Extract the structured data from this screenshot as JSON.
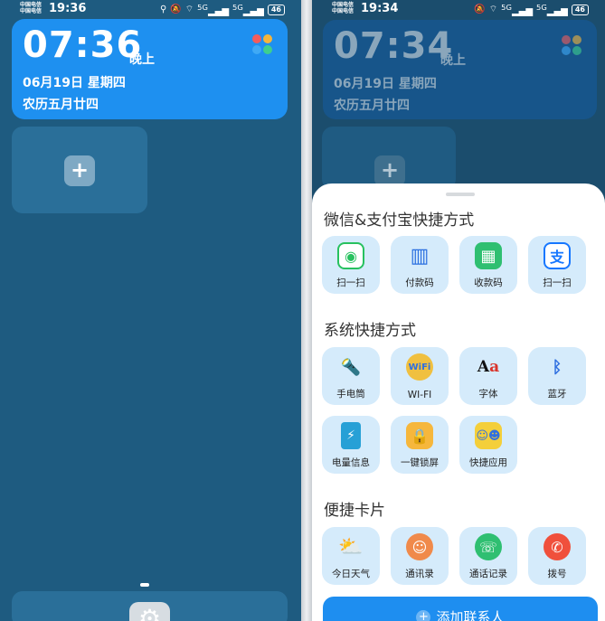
{
  "left": {
    "status": {
      "carrier1": "中国电信",
      "carrier2": "中国电信",
      "time": "19:36",
      "signal1": "5G",
      "signal2": "5G",
      "battery": "46"
    },
    "clock": {
      "time": "07:36",
      "period": "晚上",
      "date": "06月19日  星期四",
      "lunar": "农历五月廿四"
    },
    "add_label": "+"
  },
  "right": {
    "status": {
      "carrier1": "中国电信",
      "carrier2": "中国电信",
      "time": "19:34",
      "signal1": "5G",
      "signal2": "5G",
      "battery": "46"
    },
    "clock": {
      "time": "07:34",
      "period": "晚上",
      "date": "06月19日  星期四",
      "lunar": "农历五月廿四"
    },
    "add_label": "+",
    "sheet": {
      "sections": [
        {
          "title": "微信&支付宝快捷方式",
          "items": [
            {
              "label": "扫一扫",
              "icon": "wechat-scan-icon"
            },
            {
              "label": "付款码",
              "icon": "barcode-icon"
            },
            {
              "label": "收款码",
              "icon": "qr-code-icon"
            },
            {
              "label": "扫一扫",
              "icon": "alipay-scan-icon"
            }
          ]
        },
        {
          "title": "系统快捷方式",
          "items": [
            {
              "label": "手电筒",
              "icon": "flashlight-icon"
            },
            {
              "label": "WI-FI",
              "icon": "wifi-icon"
            },
            {
              "label": "字体",
              "icon": "font-icon"
            },
            {
              "label": "蓝牙",
              "icon": "bluetooth-icon"
            },
            {
              "label": "电量信息",
              "icon": "battery-icon"
            },
            {
              "label": "一键锁屏",
              "icon": "lock-icon"
            },
            {
              "label": "快捷应用",
              "icon": "quick-apps-icon"
            }
          ]
        },
        {
          "title": "便捷卡片",
          "items": [
            {
              "label": "今日天气",
              "icon": "weather-icon"
            },
            {
              "label": "通讯录",
              "icon": "contacts-icon"
            },
            {
              "label": "通话记录",
              "icon": "call-log-icon"
            },
            {
              "label": "拨号",
              "icon": "dial-icon"
            }
          ]
        }
      ],
      "add_contact": "添加联系人",
      "add_contact_glyph": "+"
    }
  },
  "colors": {
    "accent": "#1e8ef0",
    "tile_bg": "#d5ebfb",
    "wallpaper": "#1e5b80"
  }
}
